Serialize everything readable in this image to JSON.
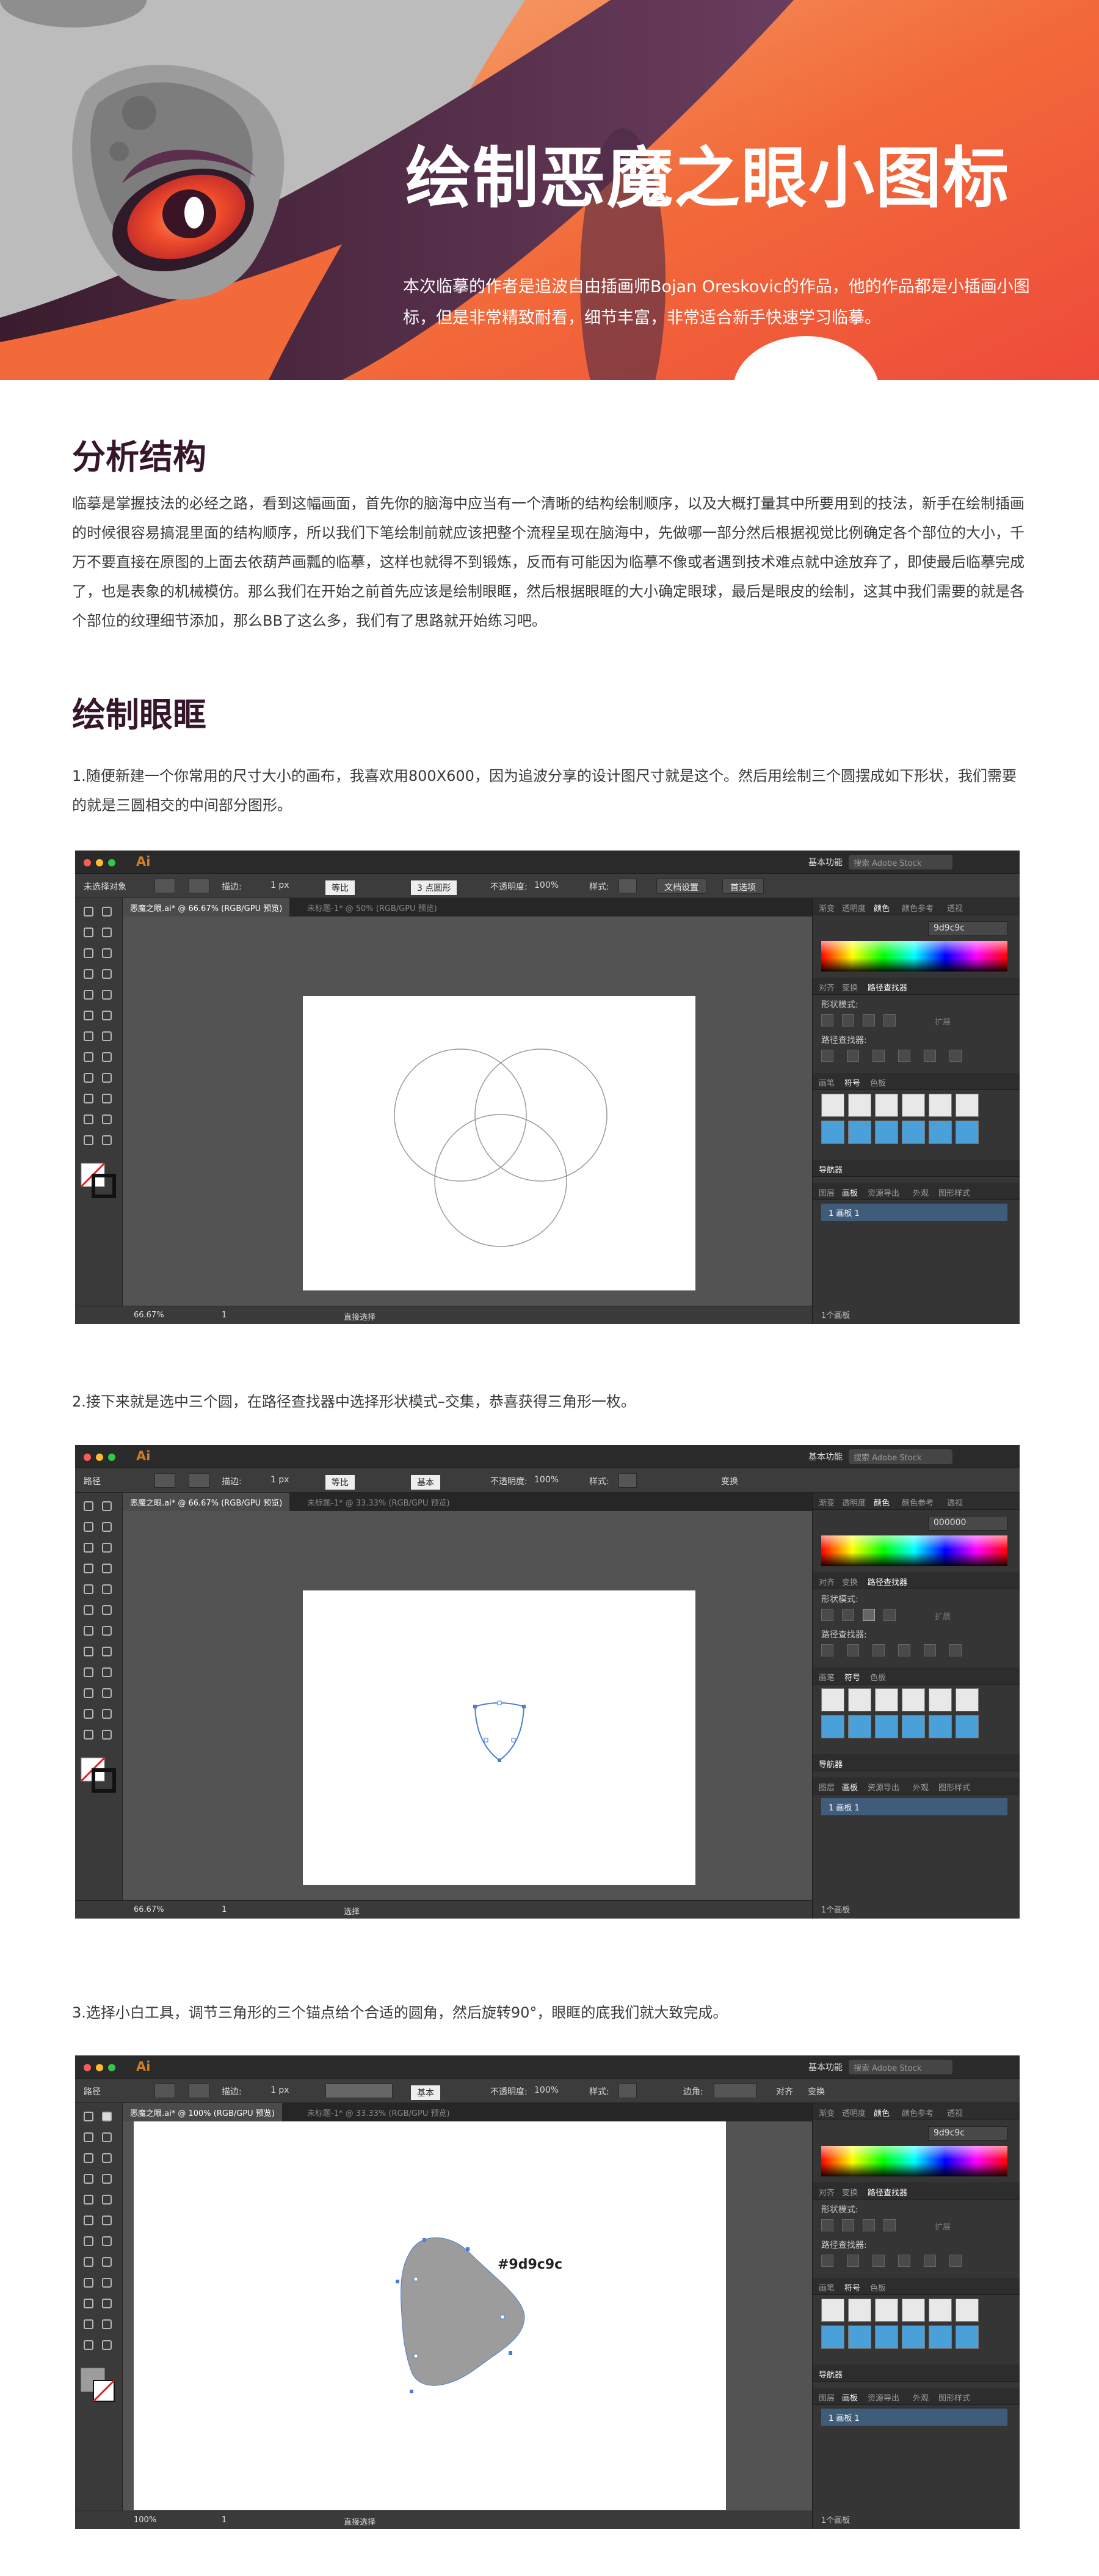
{
  "banner": {
    "title": "绘制恶魔之眼小图标",
    "subtitle": "本次临摹的作者是追波自由插画师Bojan Oreskovic的作品，他的作品都是小插画小图标，但是非常精致耐看，细节丰富，非常适合新手快速学习临摹。"
  },
  "sections": {
    "analysis_title": "分析结构",
    "analysis_text": "临摹是掌握技法的必经之路，看到这幅画面，首先你的脑海中应当有一个清晰的结构绘制顺序，以及大概打量其中所要用到的技法，新手在绘制插画的时候很容易搞混里面的结构顺序，所以我们下笔绘制前就应该把整个流程呈现在脑海中，先做哪一部分然后根据视觉比例确定各个部位的大小，千万不要直接在原图的上面去依葫芦画瓢的临摹，这样也就得不到锻炼，反而有可能因为临摹不像或者遇到技术难点就中途放弃了，即使最后临摹完成了，也是表象的机械模仿。那么我们在开始之前首先应该是绘制眼眶，然后根据眼眶的大小确定眼球，最后是眼皮的绘制，这其中我们需要的就是各个部位的纹理细节添加，那么BB了这么多，我们有了思路就开始练习吧。",
    "eye_socket_title": "绘制眼眶",
    "step1": "1.随便新建一个你常用的尺寸大小的画布，我喜欢用800X600，因为追波分享的设计图尺寸就是这个。然后用绘制三个圆摆成如下形状，我们需要的就是三圆相交的中间部分图形。",
    "step2": "2.接下来就是选中三个圆，在路径查找器中选择形状模式–交集，恭喜获得三角形一枚。",
    "step3": "3.选择小白工具，调节三角形的三个锚点给个合适的圆角，然后旋转90°，眼眶的底我们就大致完成。"
  },
  "ui": {
    "app": "Ai",
    "workspace": "基本功能",
    "search": "搜索 Adobe Stock",
    "panel_tabs": [
      "渐变",
      "透明度",
      "颜色",
      "颜色参考",
      "透视"
    ],
    "panel_tabs2": [
      "对齐",
      "变换",
      "路径查找器"
    ],
    "shape_modes": "形状模式:",
    "pathfinder": "路径查找器:",
    "expand": "扩展",
    "lib_tabs": [
      "画笔",
      "符号",
      "色板"
    ],
    "nav": "导航器",
    "layer_tabs": [
      "图层",
      "画板",
      "资源导出",
      "外观",
      "图形样式"
    ],
    "artboard_count": "1个画板",
    "artboard_row": "1  画板 1",
    "stroke_label": "描边:",
    "opacity_label": "不透明度:",
    "opacity_value": "100%",
    "style_label": "样式:",
    "stroke_value": "1 px",
    "uniform": "等比",
    "basic": "基本",
    "point_round": "3 点圆形",
    "doc_setup": "文档设置",
    "prefs": "首选项",
    "transform": "变换",
    "align": "对齐",
    "corner": "边角:"
  },
  "shot1": {
    "mode": "未选择对象",
    "tab_active": "恶魔之眼.ai* @ 66.67% (RGB/GPU 预览)",
    "tab_other": "未标题-1* @ 50% (RGB/GPU 预览)",
    "zoom": "66.67%",
    "page": "1",
    "tool_status": "直接选择",
    "hex": "9d9c9c"
  },
  "shot2": {
    "mode": "路径",
    "tab_active": "恶魔之眼.ai* @ 66.67% (RGB/GPU 预览)",
    "tab_other": "未标题-1* @ 33.33% (RGB/GPU 预览)",
    "zoom": "66.67%",
    "page": "1",
    "tool_status": "选择",
    "hex": "000000"
  },
  "shot3": {
    "mode": "路径",
    "tab_active": "恶魔之眼.ai* @ 100% (RGB/GPU 预览)",
    "tab_other": "未标题-1* @ 33.33% (RGB/GPU 预览)",
    "zoom": "100%",
    "page": "1",
    "tool_status": "直接选择",
    "hex": "9d9c9c",
    "annotation": "#9d9c9c"
  },
  "colors": {
    "title_dark": "#35162b",
    "accent_orange": "#f26a3a",
    "shape_gray": "#9d9c9c"
  }
}
